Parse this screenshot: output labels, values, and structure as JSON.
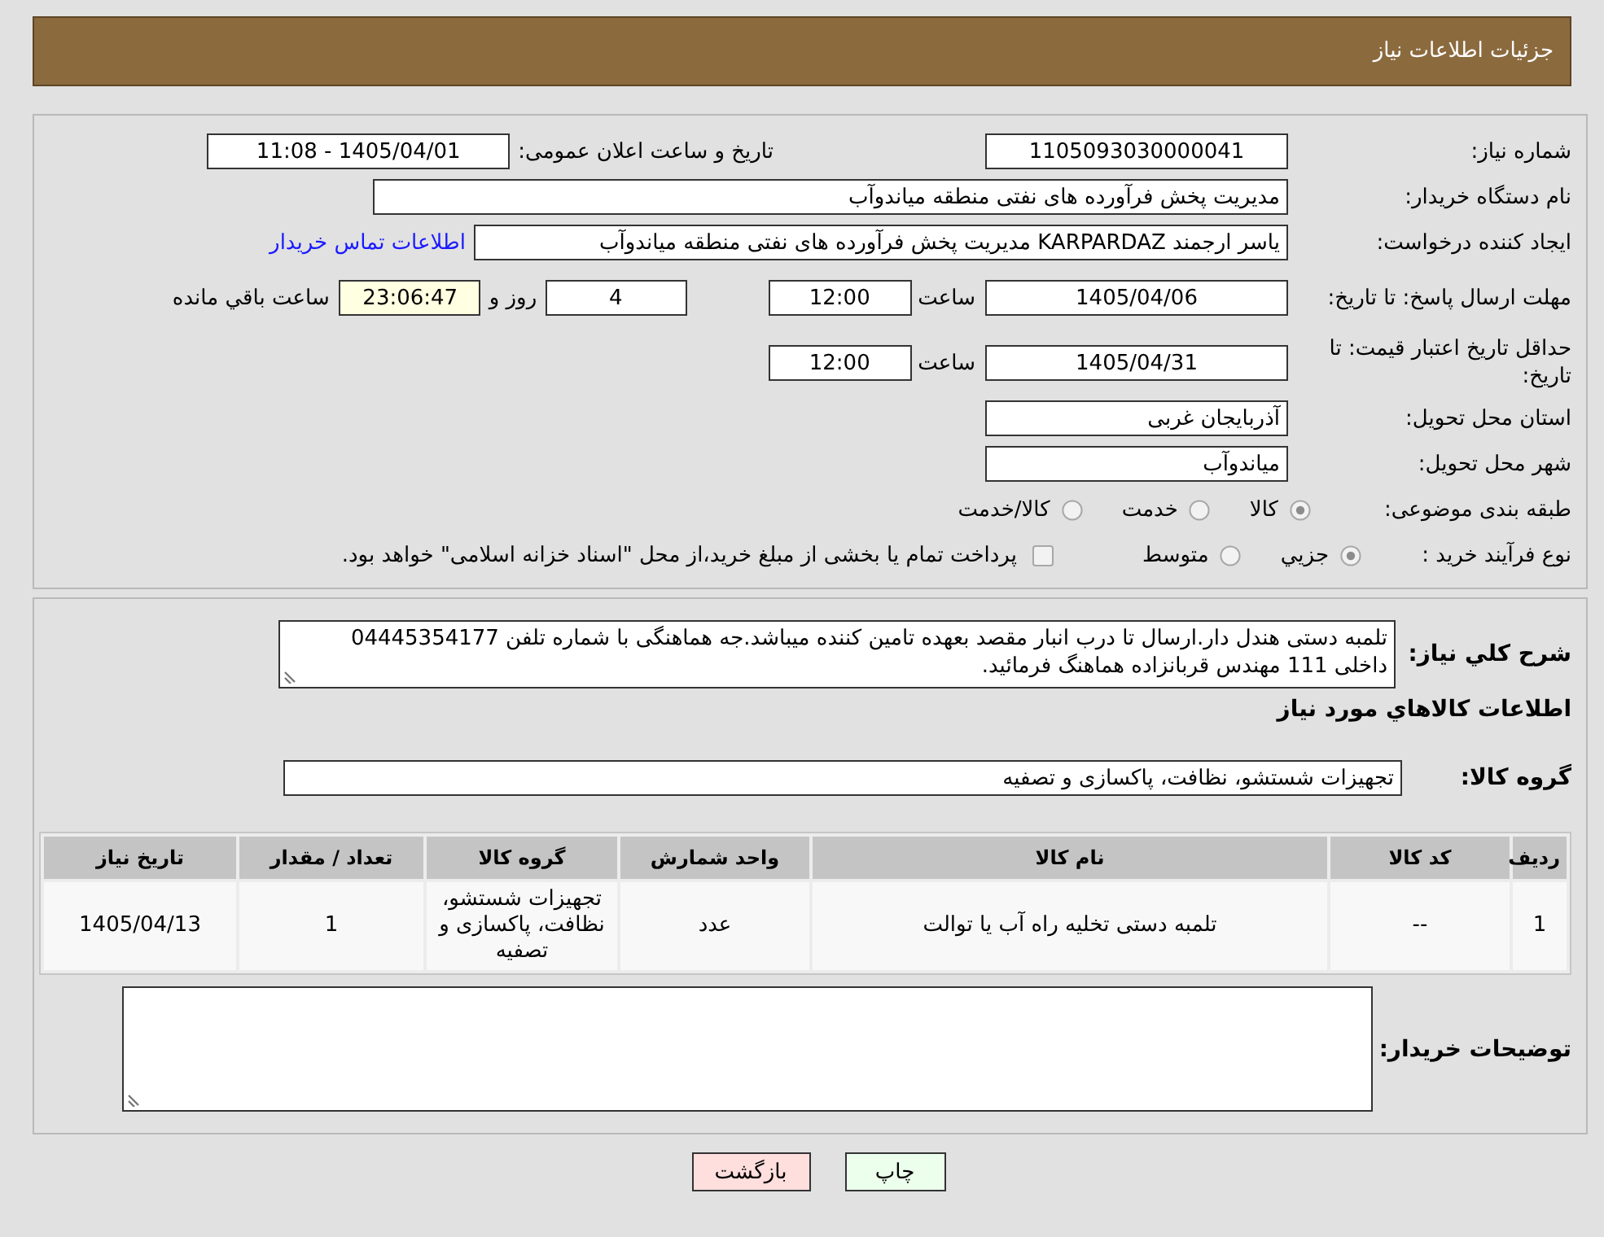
{
  "header": {
    "title": "جزئیات اطلاعات نیاز"
  },
  "details": {
    "need_number": {
      "label": "شماره نیاز:",
      "value": "1105093030000041"
    },
    "announce_datetime": {
      "label": "تاریخ و ساعت اعلان عمومی:",
      "value": "1405/04/01 - 11:08"
    },
    "buyer_org": {
      "label": "نام دستگاه خریدار:",
      "value": "مدیریت پخش فرآورده های نفتی منطقه میاندوآب"
    },
    "requester": {
      "label": "ایجاد کننده درخواست:",
      "value": "یاسر ارجمند KARPARDAZ مدیریت پخش فرآورده های نفتی منطقه میاندوآب",
      "contact_link": "اطلاعات تماس خریدار"
    },
    "reply_deadline": {
      "label": "مهلت ارسال پاسخ: تا تاریخ:",
      "date": "1405/04/06",
      "time_label": "ساعت",
      "time": "12:00",
      "days": "4",
      "days_label": "روز و",
      "remaining": "23:06:47",
      "remaining_label": "ساعت باقي مانده"
    },
    "price_validity": {
      "label": "حداقل تاریخ اعتبار قیمت: تا تاریخ:",
      "date": "1405/04/31",
      "time_label": "ساعت",
      "time": "12:00"
    },
    "province": {
      "label": "استان محل تحویل:",
      "value": "آذربایجان غربی"
    },
    "city": {
      "label": "شهر محل تحویل:",
      "value": "میاندوآب"
    },
    "classification": {
      "label": "طبقه بندی موضوعی:",
      "options": [
        {
          "label": "کالا",
          "selected": true
        },
        {
          "label": "خدمت",
          "selected": false
        },
        {
          "label": "کالا/خدمت",
          "selected": false
        }
      ]
    },
    "purchase_type": {
      "label": "نوع فرآیند خرید :",
      "options": [
        {
          "label": "جزيي",
          "selected": true
        },
        {
          "label": "متوسط",
          "selected": false
        }
      ],
      "treasury": {
        "label": "پرداخت تمام یا بخشی از مبلغ خرید،از محل \"اسناد خزانه اسلامی\" خواهد بود.",
        "checked": false
      }
    }
  },
  "need_info": {
    "description_label": "شرح كلي نياز:",
    "description": "تلمبه دستی هندل دار.ارسال تا درب انبار مقصد بعهده تامین کننده میباشد.جه هماهنگی با شماره تلفن 04445354177 داخلی 111 مهندس قربانزاده هماهنگ فرمائید.",
    "goods_heading": "اطلاعات كالاهاي مورد نياز",
    "group_label": "گروه کالا:",
    "group": "تجهیزات شستشو، نظافت، پاکسازی و تصفیه",
    "table": {
      "columns": [
        "ردیف",
        "کد کالا",
        "نام کالا",
        "واحد شمارش",
        "گروه کالا",
        "تعداد / مقدار",
        "تاریخ نیاز"
      ],
      "rows": [
        [
          "1",
          "--",
          "تلمبه دستی تخلیه راه آب یا توالت",
          "عدد",
          "تجهیزات شستشو، نظافت، پاکسازی و تصفیه",
          "1",
          "1405/04/13"
        ]
      ]
    },
    "notes_label": "توضیحات خریدار:"
  },
  "buttons": [
    {
      "label": "چاپ",
      "kind": "print"
    },
    {
      "label": "بازگشت",
      "kind": "back"
    }
  ]
}
